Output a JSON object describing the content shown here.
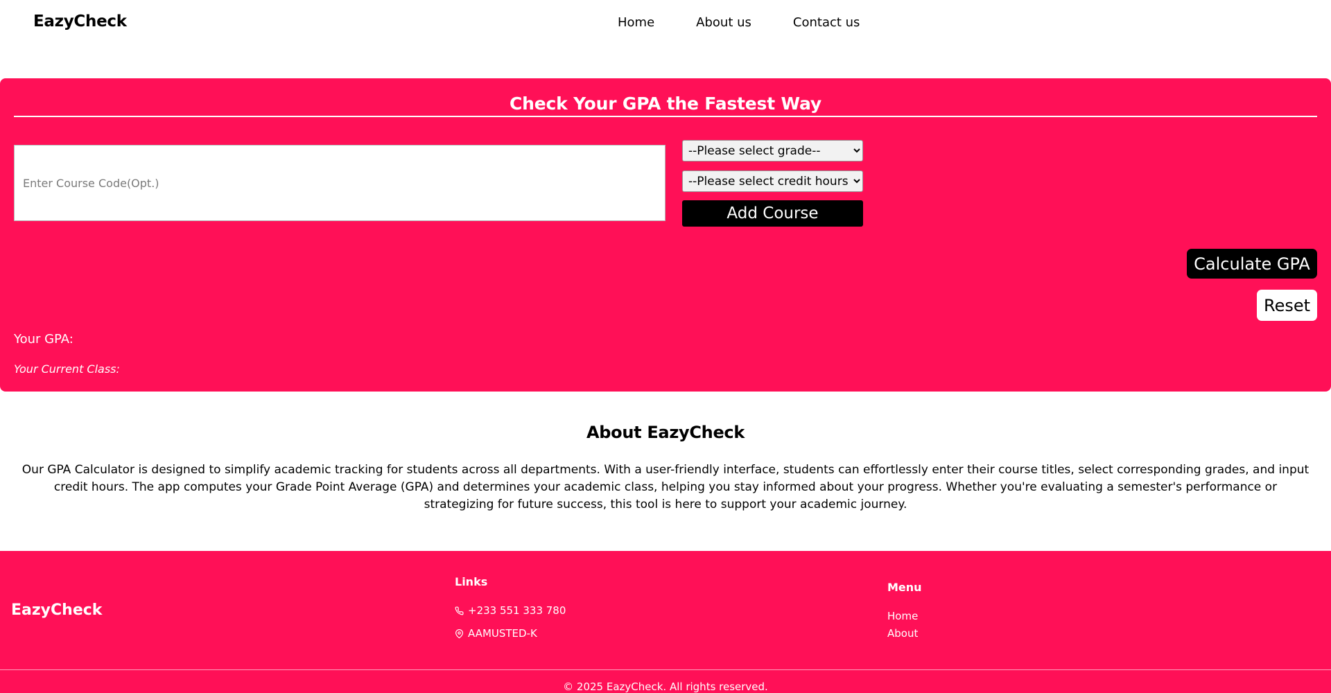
{
  "header": {
    "brand": "EazyCheck",
    "nav": [
      "Home",
      "About us",
      "Contact us"
    ]
  },
  "calculator": {
    "title": "Check Your GPA the Fastest Way",
    "course_placeholder": "Enter Course Code(Opt.)",
    "grade_select": "--Please select grade--",
    "credit_select": "--Please select credit hours--",
    "add_button": "Add Course",
    "calculate_button": "Calculate GPA",
    "reset_button": "Reset",
    "gpa_label": "Your GPA:",
    "class_label": "Your Current Class:"
  },
  "about": {
    "title": "About EazyCheck",
    "text": "Our GPA Calculator is designed to simplify academic tracking for students across all departments. With a user-friendly interface, students can effortlessly enter their course titles, select corresponding grades, and input credit hours. The app computes your Grade Point Average (GPA) and determines your academic class, helping you stay informed about your progress. Whether you're evaluating a semester's performance or strategizing for future success, this tool is here to support your academic journey."
  },
  "footer": {
    "brand": "EazyCheck",
    "links_title": "Links",
    "phone": "+233 551 333 780",
    "location": "AAMUSTED-K",
    "menu_title": "Menu",
    "menu": [
      "Home",
      "About"
    ],
    "copyright": "© 2025 EazyCheck. All rights reserved."
  },
  "colors": {
    "accent": "#ff1057",
    "button_dark": "#000000"
  }
}
